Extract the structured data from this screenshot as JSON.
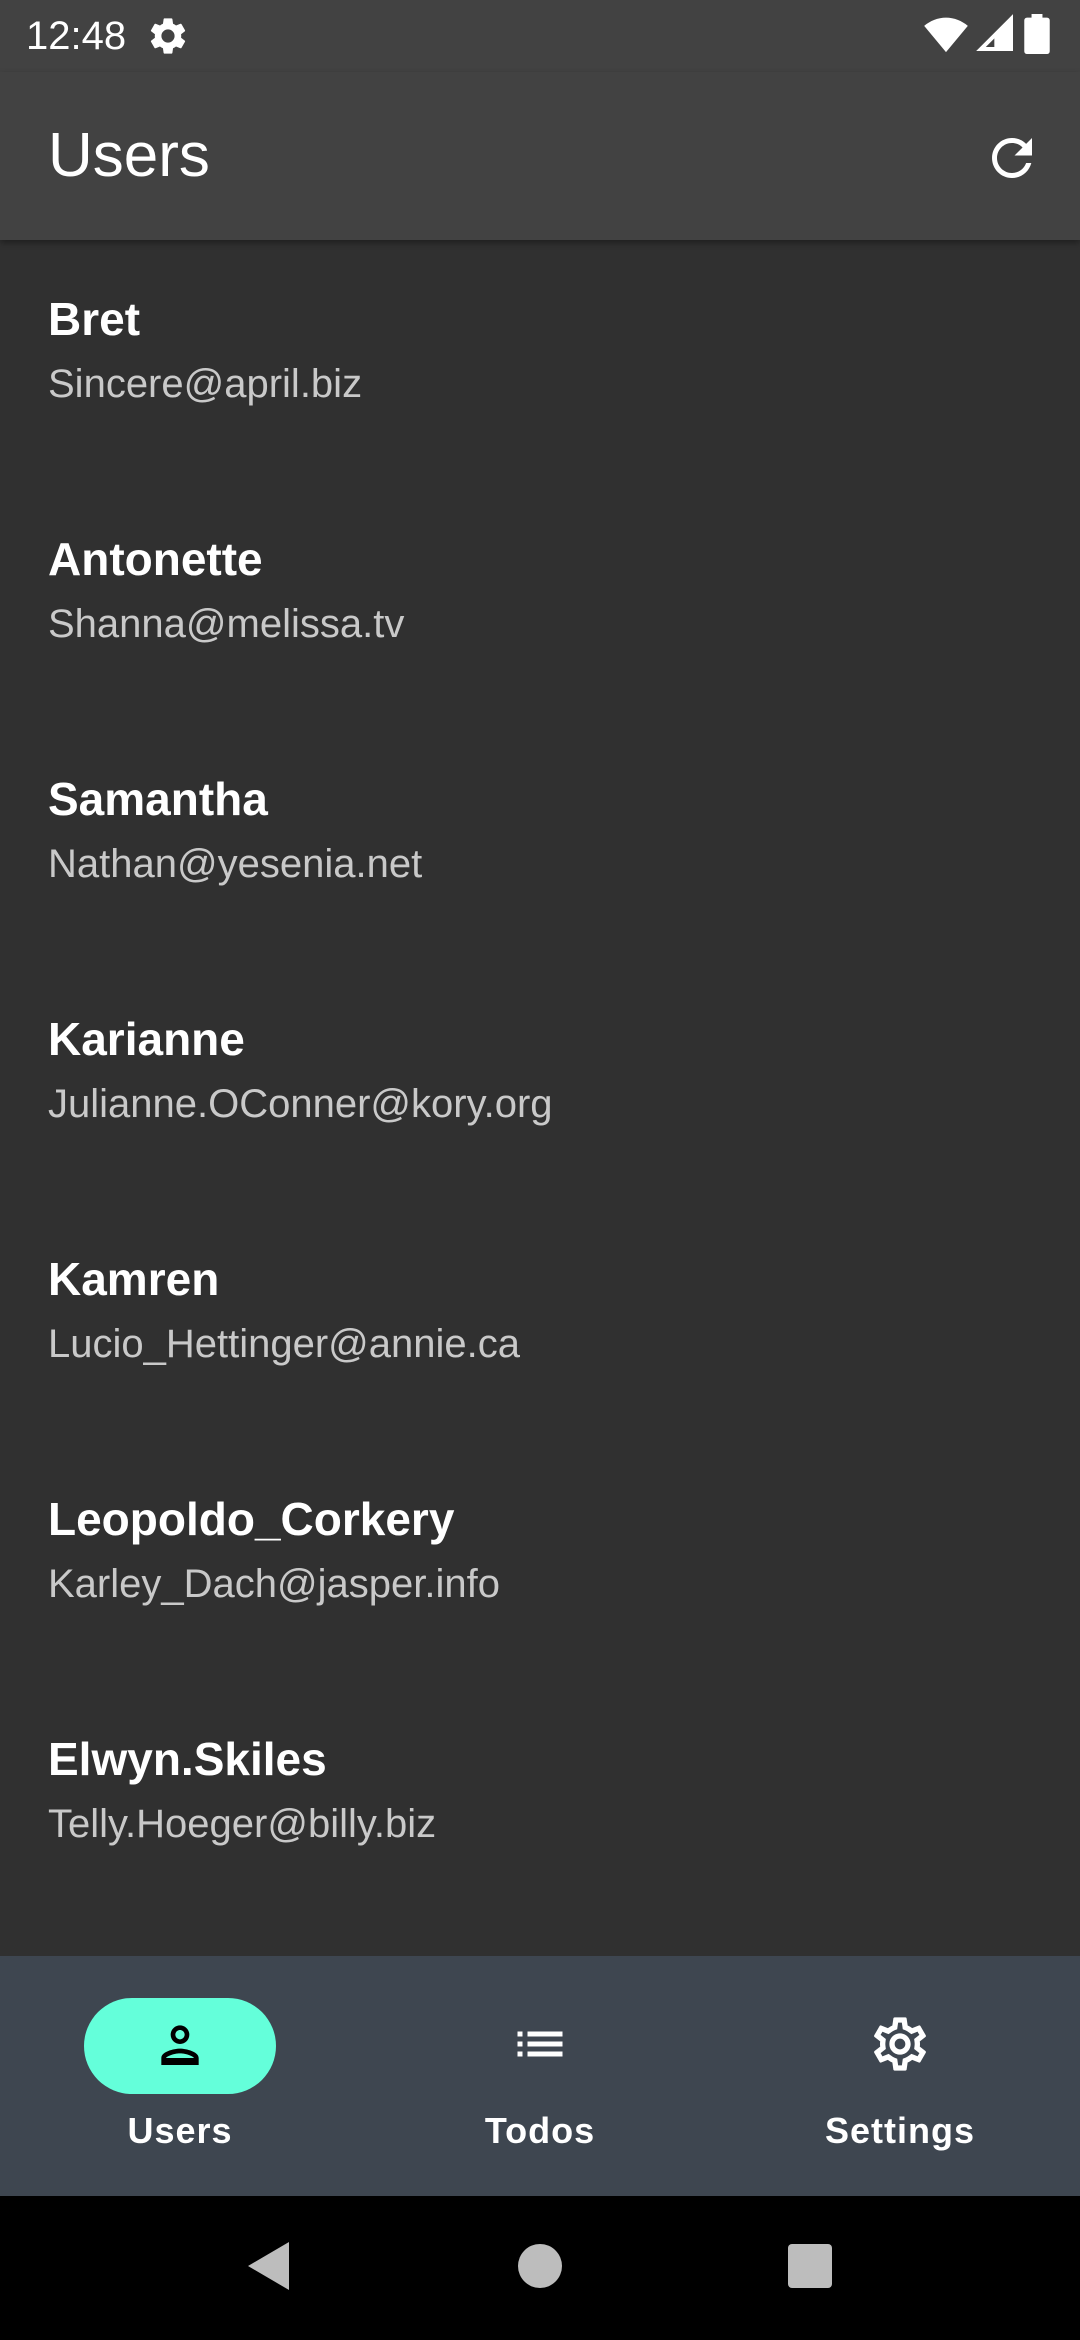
{
  "status_bar": {
    "time": "12:48",
    "icons": [
      "settings-gear-icon",
      "wifi-icon",
      "cellular-signal-icon",
      "battery-icon"
    ]
  },
  "app_bar": {
    "title": "Users",
    "action_icon": "refresh-icon"
  },
  "users": [
    {
      "username": "Bret",
      "email": "Sincere@april.biz"
    },
    {
      "username": "Antonette",
      "email": "Shanna@melissa.tv"
    },
    {
      "username": "Samantha",
      "email": "Nathan@yesenia.net"
    },
    {
      "username": "Karianne",
      "email": "Julianne.OConner@kory.org"
    },
    {
      "username": "Kamren",
      "email": "Lucio_Hettinger@annie.ca"
    },
    {
      "username": "Leopoldo_Corkery",
      "email": "Karley_Dach@jasper.info"
    },
    {
      "username": "Elwyn.Skiles",
      "email": "Telly.Hoeger@billy.biz"
    }
  ],
  "bottom_nav": {
    "items": [
      {
        "label": "Users",
        "icon": "person-icon",
        "active": true
      },
      {
        "label": "Todos",
        "icon": "list-icon",
        "active": false
      },
      {
        "label": "Settings",
        "icon": "gear-icon",
        "active": false
      }
    ]
  },
  "colors": {
    "background": "#303030",
    "app_bar": "#424242",
    "bottom_nav": "#3e4650",
    "active_indicator": "#64ffda",
    "secondary_text": "#c9c9c9"
  }
}
